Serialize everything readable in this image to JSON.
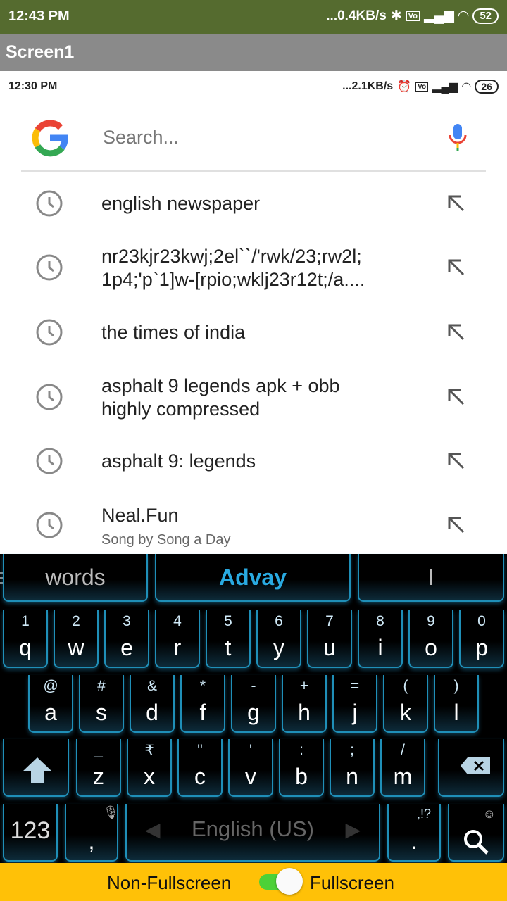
{
  "outer_status": {
    "time": "12:43 PM",
    "speed": "...0.4KB/s",
    "battery": "52"
  },
  "app_title": "Screen1",
  "inner_status": {
    "time": "12:30 PM",
    "speed": "...2.1KB/s",
    "battery": "26"
  },
  "search": {
    "placeholder": "Search..."
  },
  "suggestions": [
    {
      "text": "english newspaper",
      "sub": ""
    },
    {
      "text": "nr23kjr23kwj;2el``/'rwk/23;rw2l;\n1p4;'p`1]w-[rpio;wklj23r12t;/a....",
      "sub": ""
    },
    {
      "text": "the times of india",
      "sub": ""
    },
    {
      "text": "asphalt 9 legends apk + obb\nhighly compressed",
      "sub": ""
    },
    {
      "text": "asphalt 9: legends",
      "sub": ""
    },
    {
      "text": "Neal.Fun",
      "sub": "Song by Song a Day"
    }
  ],
  "keyboard": {
    "candidates": [
      "words",
      "Advay",
      "I"
    ],
    "row1": [
      "q",
      "w",
      "e",
      "r",
      "t",
      "y",
      "u",
      "i",
      "o",
      "p"
    ],
    "row1_hints": [
      "1",
      "2",
      "3",
      "4",
      "5",
      "6",
      "7",
      "8",
      "9",
      "0"
    ],
    "row2": [
      "a",
      "s",
      "d",
      "f",
      "g",
      "h",
      "j",
      "k",
      "l"
    ],
    "row2_hints": [
      "@",
      "#",
      "&",
      "*",
      "-",
      "+",
      "=",
      "(",
      ")"
    ],
    "row3": [
      "z",
      "x",
      "c",
      "v",
      "b",
      "n",
      "m"
    ],
    "row3_hints": [
      "_",
      "₹",
      "\"",
      "'",
      ":",
      ";",
      "/"
    ],
    "numbers_key": "123",
    "comma_key": ",",
    "space_label": "English (US)",
    "period_key": ".",
    "period_hint": ",!?"
  },
  "bottom_bar": {
    "left_label": "Non-Fullscreen",
    "right_label": "Fullscreen",
    "toggle_on": true
  },
  "colors": {
    "outer_status": "#556b2f",
    "title_bar": "#8a8a8a",
    "key_glow": "#29aae1",
    "candidate_active": "#29aae1",
    "bottom_bar": "#ffc107",
    "toggle_track": "#4cd137"
  }
}
